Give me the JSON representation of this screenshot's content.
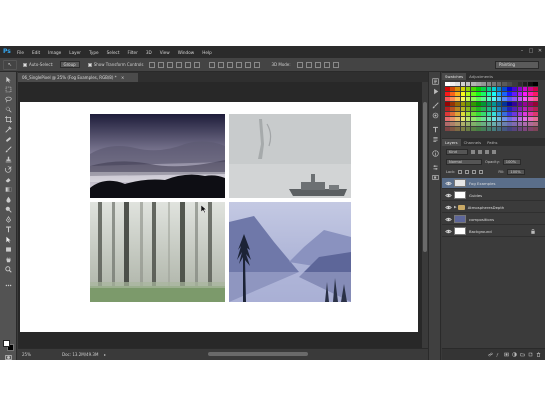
{
  "app": {
    "logo": "Ps",
    "menu": [
      "File",
      "Edit",
      "Image",
      "Layer",
      "Type",
      "Select",
      "Filter",
      "3D",
      "View",
      "Window",
      "Help"
    ],
    "window_controls": [
      "–",
      "□",
      "✕"
    ]
  },
  "options_bar": {
    "tool_glyph": "↖",
    "auto_select_label": "Auto-Select:",
    "auto_select_value": "Group",
    "transform_label": "Show Transform Controls",
    "mode_label": "3D Mode:",
    "workspace": "Painting"
  },
  "document": {
    "tab_title": "06_SinglePixel @ 25% (Fog Examples, RGB/8) *",
    "close_glyph": "×"
  },
  "status_bar": {
    "zoom": "25%",
    "doc_info": "Doc: 13.2M/49.3M",
    "arrow": "▸"
  },
  "panels": {
    "swatches_tabs": [
      "Swatches",
      "Adjustments"
    ],
    "layers_tabs": [
      "Layers",
      "Channels",
      "Paths"
    ],
    "kind_label": "Kind",
    "blend_mode": "Normal",
    "opacity_label": "Opacity:",
    "opacity_value": "100%",
    "lock_label": "Lock:",
    "fill_label": "Fill:",
    "fill_value": "100%",
    "layers": [
      {
        "name": "Fog Examples",
        "type": "layer",
        "selected": true
      },
      {
        "name": "Guides",
        "type": "layer",
        "selected": false
      },
      {
        "name": "AtmospheresDepth",
        "type": "group",
        "selected": false
      },
      {
        "name": "compositions",
        "type": "layer",
        "selected": false
      },
      {
        "name": "Background",
        "type": "layer",
        "selected": false,
        "locked": true
      }
    ]
  },
  "colors": {
    "menubar_bg": "#2b2b2b",
    "panel_bg": "#3b3b3b",
    "selected_layer": "#5a6e8a",
    "ps_blue": "#34a7f0"
  }
}
